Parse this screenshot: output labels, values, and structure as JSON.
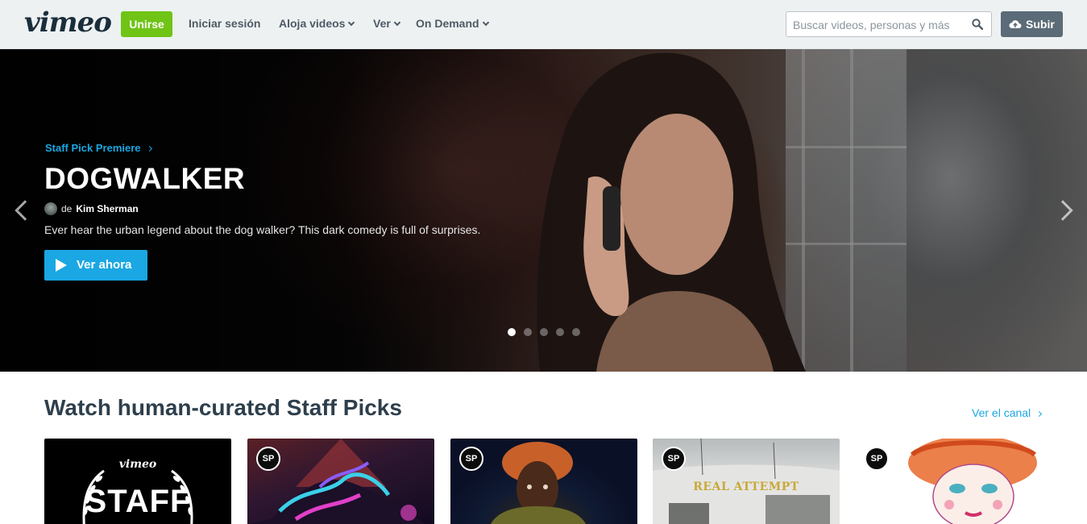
{
  "nav": {
    "logo": "vimeo",
    "join_label": "Unirse",
    "login_label": "Iniciar sesión",
    "host_label": "Aloja videos",
    "watch_label": "Ver",
    "ondemand_label": "On Demand",
    "search_placeholder": "Buscar videos, personas y más",
    "upload_label": "Subir"
  },
  "hero": {
    "kicker": "Staff Pick Premiere",
    "title": "DOGWALKER",
    "by_label": "de",
    "author": "Kim Sherman",
    "description": "Ever hear the urban legend about the dog walker? This dark comedy is full of surprises.",
    "cta_label": "Ver ahora",
    "slide_count": 5,
    "active_slide": 1
  },
  "staff_picks": {
    "title": "Watch human-curated Staff Picks",
    "channel_link": "Ver el canal",
    "badge_text": "SP",
    "thumbs": [
      {
        "brand": "vimeo",
        "title": "STAFF"
      },
      {
        "badge": "SP"
      },
      {
        "badge": "SP"
      },
      {
        "badge": "SP",
        "overlay_title": "REAL ATTEMPT"
      },
      {
        "badge": "SP"
      }
    ]
  },
  "colors": {
    "accent_blue": "#1aa7e3",
    "join_green": "#6fc416",
    "upload_gray": "#5b6b77",
    "nav_bg": "#eef1f2",
    "title_dark": "#2e3f4c"
  }
}
